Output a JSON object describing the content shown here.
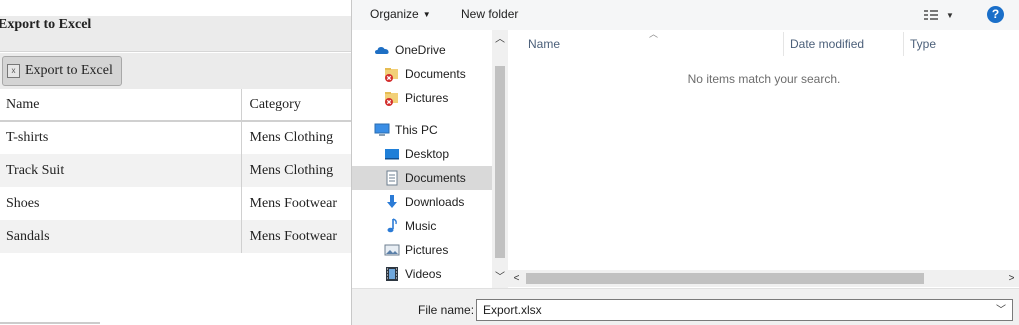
{
  "web": {
    "page_title": "Export to Excel",
    "export_button_label": "Export to Excel",
    "table": {
      "headers": [
        "Name",
        "Category"
      ],
      "rows": [
        [
          "T-shirts",
          "Mens Clothing"
        ],
        [
          "Track Suit",
          "Mens Clothing"
        ],
        [
          "Shoes",
          "Mens Footwear"
        ],
        [
          "Sandals",
          "Mens Footwear"
        ]
      ]
    }
  },
  "dialog": {
    "toolbar": {
      "organize_label": "Organize",
      "new_folder_label": "New folder",
      "help_label": "?"
    },
    "nav": {
      "items": [
        {
          "label": "OneDrive",
          "icon": "cloud-icon"
        },
        {
          "label": "Documents",
          "icon": "folder-error-icon"
        },
        {
          "label": "Pictures",
          "icon": "folder-error-icon"
        },
        {
          "label": "This PC",
          "icon": "computer-icon"
        },
        {
          "label": "Desktop",
          "icon": "desktop-icon"
        },
        {
          "label": "Documents",
          "icon": "documents-icon",
          "selected": true
        },
        {
          "label": "Downloads",
          "icon": "download-arrow-icon"
        },
        {
          "label": "Music",
          "icon": "music-note-icon"
        },
        {
          "label": "Pictures",
          "icon": "pictures-icon"
        },
        {
          "label": "Videos",
          "icon": "film-icon"
        }
      ]
    },
    "columns": [
      "Name",
      "Date modified",
      "Type"
    ],
    "empty_message": "No items match your search.",
    "file_name_label": "File name:",
    "file_name_value": "Export.xlsx",
    "colors": {
      "help_blue": "#1a6fc9",
      "selection": "#d9d9d9",
      "header_text": "#4c607a"
    }
  }
}
